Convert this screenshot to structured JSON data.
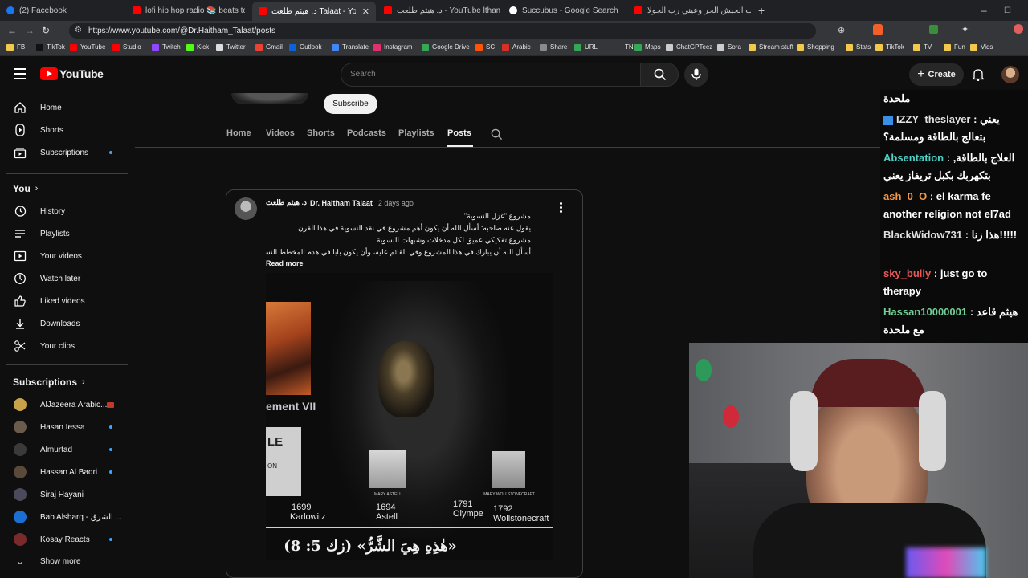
{
  "browser": {
    "tabs": [
      {
        "title": "(2) Facebook",
        "color": "#1877f2"
      },
      {
        "title": "lofi hip hop radio 📚 beats to rel",
        "color": "#ff0000"
      },
      {
        "title": "د. هيثم طلعت Talaat - YouTube",
        "color": "#ff0000"
      },
      {
        "title": "د. هيثم طلعت - YouTube ltham Talaat",
        "color": "#ff0000"
      },
      {
        "title": "Succubus - Google Search",
        "color": "#ffffff"
      },
      {
        "title": "عيني رب الجيش الحر وعيني رب الجولا",
        "color": "#ff0000"
      }
    ],
    "new_tab": "+",
    "url": "https://www.youtube.com/@Dr.Haitham_Talaat/posts",
    "bookmarks": [
      {
        "label": "FB",
        "color": "#f2c94c"
      },
      {
        "label": "TikTok",
        "color": "#111111"
      },
      {
        "label": "YouTube",
        "color": "#ff0000"
      },
      {
        "label": "Studio",
        "color": "#ff0000"
      },
      {
        "label": "Twitch",
        "color": "#9146ff"
      },
      {
        "label": "Kick",
        "color": "#53fc18"
      },
      {
        "label": "Twitter",
        "color": "#dddddd"
      },
      {
        "label": "Gmail",
        "color": "#ea4335"
      },
      {
        "label": "Outlook",
        "color": "#0a64d8"
      },
      {
        "label": "Translate",
        "color": "#4285f4"
      },
      {
        "label": "Instagram",
        "color": "#e1306c"
      },
      {
        "label": "Google Drive",
        "color": "#34a853"
      },
      {
        "label": "SC",
        "color": "#ff5500"
      },
      {
        "label": "Arabic",
        "color": "#d93025"
      },
      {
        "label": "Share",
        "color": "#8a8a8a"
      },
      {
        "label": "URL",
        "color": "#34a853"
      },
      {
        "label": "TN",
        "color": "#35363a"
      },
      {
        "label": "Maps",
        "color": "#34a853"
      },
      {
        "label": "ChatGPTeez",
        "color": "#cccccc"
      },
      {
        "label": "Sora",
        "color": "#cccccc"
      },
      {
        "label": "Stream stuff",
        "color": "#f2c94c"
      },
      {
        "label": "Shopping",
        "color": "#f2c94c"
      },
      {
        "label": "Stats",
        "color": "#f2c94c"
      },
      {
        "label": "TikTok",
        "color": "#f2c94c"
      },
      {
        "label": "TV",
        "color": "#f2c94c"
      },
      {
        "label": "Fun",
        "color": "#f2c94c"
      },
      {
        "label": "Vids",
        "color": "#f2c94c"
      }
    ]
  },
  "youtube": {
    "logo_text": "YouTube",
    "search_placeholder": "Search",
    "create_label": "Create",
    "sidebar": {
      "main": [
        {
          "label": "Home",
          "icon": "home-icon"
        },
        {
          "label": "Shorts",
          "icon": "shorts-icon"
        },
        {
          "label": "Subscriptions",
          "icon": "subscriptions-icon"
        }
      ],
      "you_title": "You",
      "you_items": [
        {
          "label": "History",
          "icon": "history-icon"
        },
        {
          "label": "Playlists",
          "icon": "playlists-icon"
        },
        {
          "label": "Your videos",
          "icon": "your-videos-icon"
        },
        {
          "label": "Watch later",
          "icon": "watch-later-icon"
        },
        {
          "label": "Liked videos",
          "icon": "liked-videos-icon"
        },
        {
          "label": "Downloads",
          "icon": "downloads-icon"
        },
        {
          "label": "Your clips",
          "icon": "clips-icon"
        }
      ],
      "subs_title": "Subscriptions",
      "subscriptions": [
        {
          "label": "AlJazeera Arabic...",
          "color": "#c8a24a",
          "indicator": "live"
        },
        {
          "label": "Hasan Iessa",
          "color": "#6b5b4b",
          "indicator": "dot"
        },
        {
          "label": "Almurtad",
          "color": "#3a3a3a",
          "indicator": "dot"
        },
        {
          "label": "Hassan Al Badri",
          "color": "#5a4a3a",
          "indicator": "dot"
        },
        {
          "label": "Siraj Hayani",
          "color": "#4a4a5a",
          "indicator": ""
        },
        {
          "label": "Bab Alsharq - الشرق ...",
          "color": "#1b6fd1",
          "indicator": ""
        },
        {
          "label": "Kosay Reacts",
          "color": "#7a2a2a",
          "indicator": "dot"
        }
      ],
      "show_more": "Show more"
    },
    "channel": {
      "subscribe_label": "Subscribe",
      "tabs": [
        "Home",
        "Videos",
        "Shorts",
        "Podcasts",
        "Playlists",
        "Posts"
      ],
      "active_tab": "Posts"
    },
    "post": {
      "author_ar": "د. هيثم طلعت",
      "author": "Dr. Haitham Talaat",
      "time": "2 days ago",
      "lines": [
        "مشروع \"غزل النسوية\"",
        "يقول عنه صاحبه: أسأل الله أن يكون أهم مشروع في نقد النسوية في هذا القرن.",
        "مشروع تفكيكي عميق لكل مدخلات وشبهات النسوية.",
        "أسأل الله أن يبارك في هذا المشروع وفي القائم عليه، وأن يكون بابا في هدم المخطط النسوي ..."
      ],
      "read_more": "Read more",
      "image": {
        "text_ement": "ement VII",
        "text_le": "LE",
        "text_on": "ON",
        "portrait1_caption": "MARY ASTELL",
        "portrait2_caption": "MARY WOLLSTONECRAFT",
        "timeline": [
          {
            "year": "1699",
            "name": "Karlowitz"
          },
          {
            "year": "1694",
            "name": "Astell"
          },
          {
            "year": "1791",
            "name": "Olympe"
          },
          {
            "year": "1792",
            "name": "Wollstonecraft"
          }
        ],
        "verse": "«هٰذِهِ هِيَ الشَّرُّ» (زك 5: 8)"
      }
    }
  },
  "chat": [
    {
      "user": "",
      "user_color": "#ffffff",
      "text": "ملحدة"
    },
    {
      "user": "IZZY_theslayer",
      "user_color": "#e0e0e0",
      "text": "يعني بتعالج بالطاقة ومسلمة؟"
    },
    {
      "user": "Absentation",
      "user_color": "#4fd1c5",
      "text": "العلاج بالطاقة, بتكهربك بكبل تريفاز يعني"
    },
    {
      "user": "ash_0_O",
      "user_color": "#f2994a",
      "text": "el karma fe another religion not el7ad"
    },
    {
      "user": "BlackWidow731",
      "user_color": "#e0e0e0",
      "text": "هذا زنا!!!!!"
    },
    {
      "user": "sky_bully",
      "user_color": "#eb5757",
      "text": "just go to therapy"
    },
    {
      "user": "Hassan10000001",
      "user_color": "#6fcf97",
      "text": "هيثم قاعد مع ملحدة"
    }
  ]
}
